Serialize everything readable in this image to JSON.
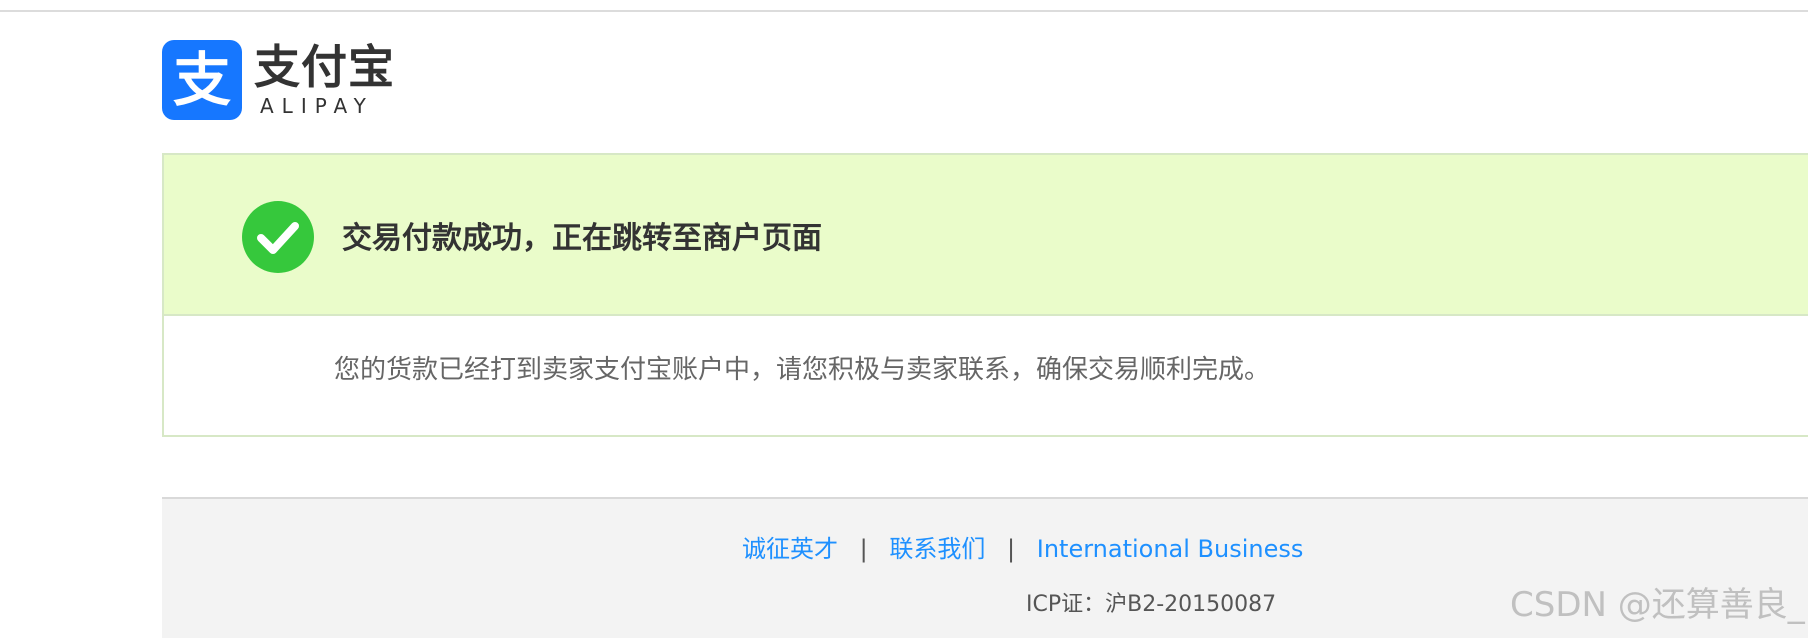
{
  "logo": {
    "mark_glyph": "支",
    "cn_name": "支付宝",
    "en_name": "ALIPAY",
    "brand_color": "#1677ff"
  },
  "status": {
    "icon": "check-circle-icon",
    "title": "交易付款成功，正在跳转至商户页面",
    "message": "您的货款已经打到卖家支付宝账户中，请您积极与卖家联系，确保交易顺利完成。",
    "banner_color": "#eafcca",
    "icon_color": "#36c83c"
  },
  "footer": {
    "links": [
      {
        "label": "诚征英才"
      },
      {
        "label": "联系我们"
      },
      {
        "label": "International Business"
      }
    ],
    "separator": "|",
    "icp": "ICP证：沪B2-20150087",
    "link_color": "#1e90ff"
  },
  "watermark": "CSDN @还算善良_"
}
